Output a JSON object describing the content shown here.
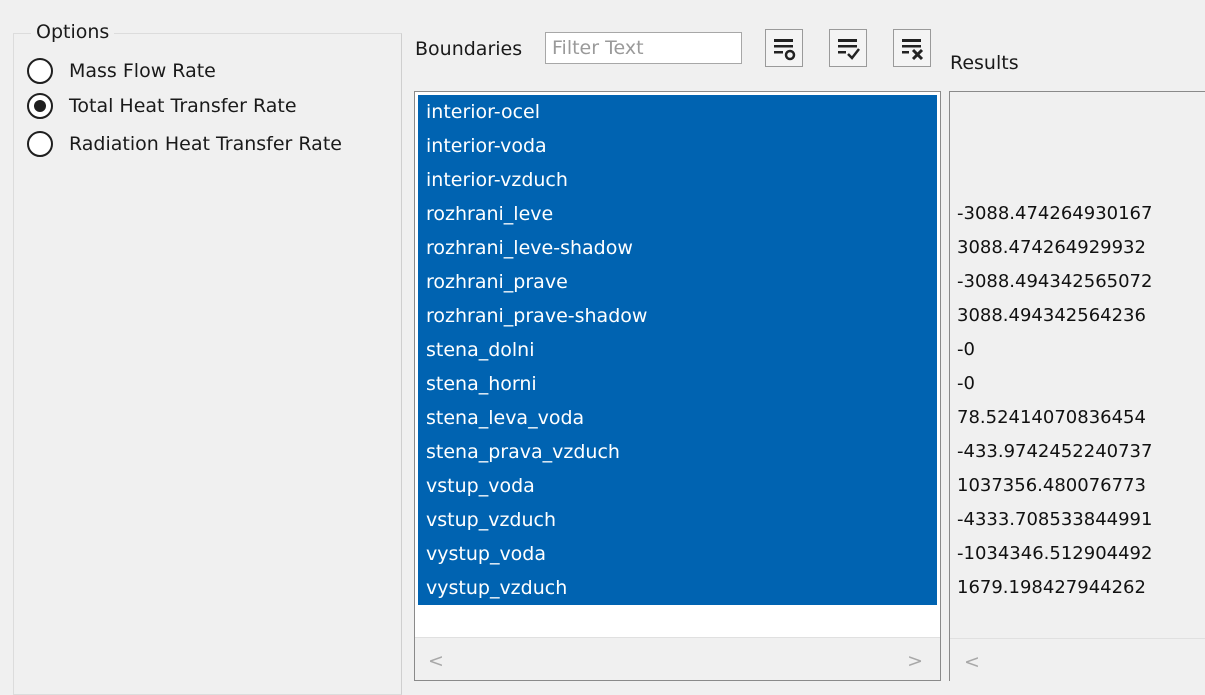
{
  "options": {
    "legend": "Options",
    "radios": [
      {
        "label": "Mass Flow Rate",
        "checked": false
      },
      {
        "label": "Total Heat Transfer Rate",
        "checked": true
      },
      {
        "label": "Radiation Heat Transfer Rate",
        "checked": false
      }
    ]
  },
  "boundaries": {
    "label": "Boundaries",
    "filter_placeholder": "Filter Text",
    "items": [
      "interior-ocel",
      "interior-voda",
      "interior-vzduch",
      "rozhrani_leve",
      "rozhrani_leve-shadow",
      "rozhrani_prave",
      "rozhrani_prave-shadow",
      "stena_dolni",
      "stena_horni",
      "stena_leva_voda",
      "stena_prava_vzduch",
      "vstup_voda",
      "vstup_vzduch",
      "vystup_voda",
      "vystup_vzduch"
    ],
    "scroll_left": "<",
    "scroll_right": ">"
  },
  "toolbar": {
    "icons": [
      "filter-options-icon",
      "select-all-icon",
      "deselect-all-icon"
    ]
  },
  "results": {
    "label": "Results",
    "values": [
      "",
      "",
      "",
      "-3088.474264930167",
      "3088.474264929932",
      "-3088.494342565072",
      "3088.494342564236",
      "-0",
      "-0",
      "78.52414070836454",
      "-433.9742452240737",
      "1037356.480076773",
      "-4333.708533844991",
      "-1034346.512904492",
      "1679.198427944262"
    ],
    "scroll_left": "<"
  },
  "colors": {
    "selection": "#0063b1",
    "background": "#f0f0f0"
  }
}
